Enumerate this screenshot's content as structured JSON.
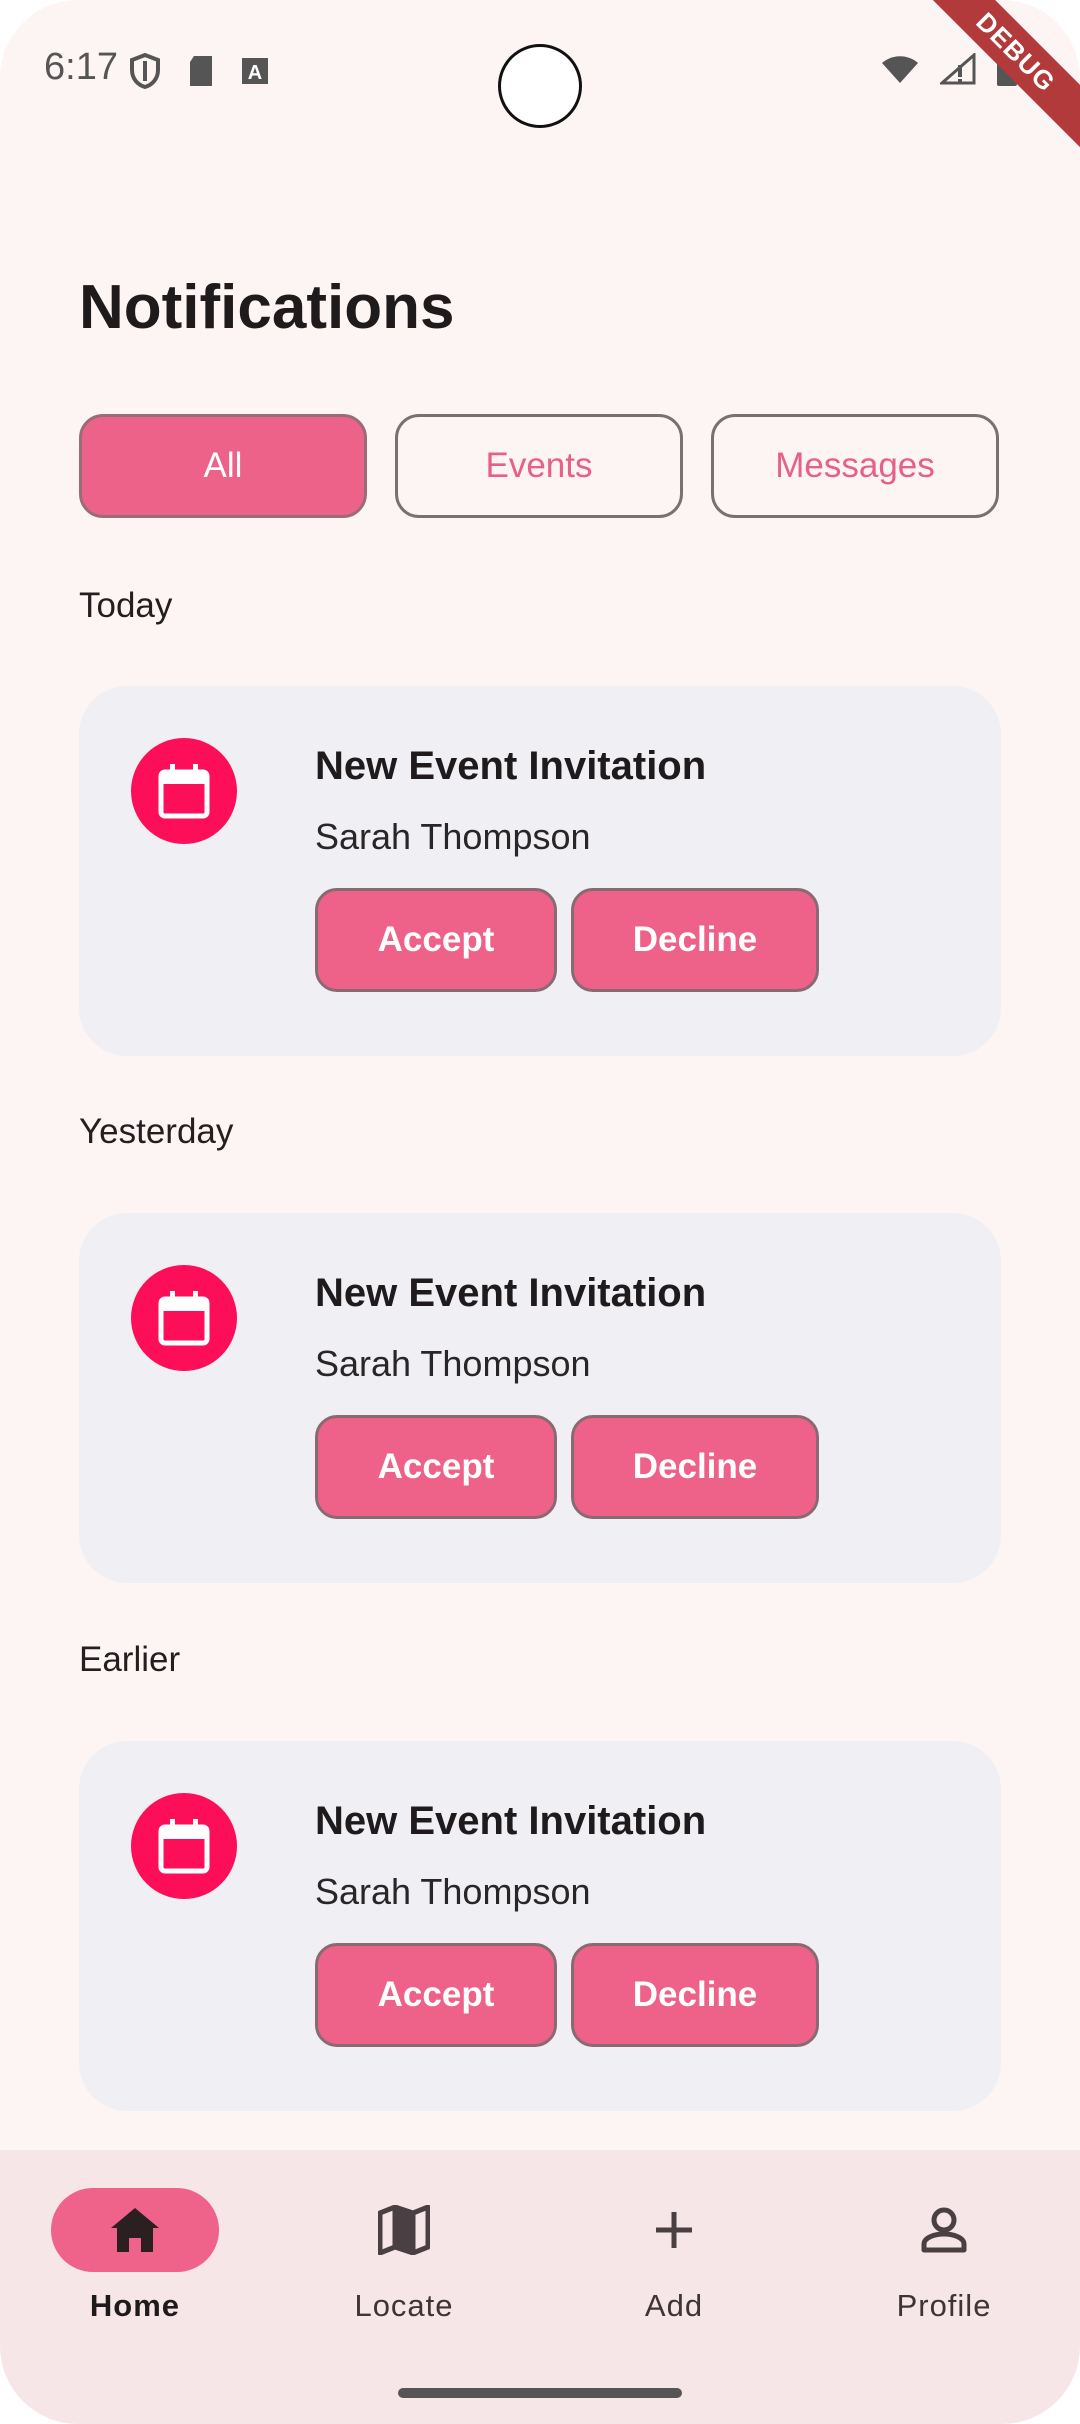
{
  "status_bar": {
    "time": "6:17",
    "debug_label": "DEBUG"
  },
  "title": "Notifications",
  "filters": [
    {
      "label": "All",
      "active": true
    },
    {
      "label": "Events",
      "active": false
    },
    {
      "label": "Messages",
      "active": false
    }
  ],
  "sections": [
    {
      "label": "Today",
      "card": {
        "title": "New Event Invitation",
        "sender": "Sarah Thompson",
        "accept_label": "Accept",
        "decline_label": "Decline",
        "icon": "calendar-icon"
      }
    },
    {
      "label": "Yesterday",
      "card": {
        "title": "New Event Invitation",
        "sender": "Sarah Thompson",
        "accept_label": "Accept",
        "decline_label": "Decline",
        "icon": "calendar-icon"
      }
    },
    {
      "label": "Earlier",
      "card": {
        "title": "New Event Invitation",
        "sender": "Sarah Thompson",
        "accept_label": "Accept",
        "decline_label": "Decline",
        "icon": "calendar-icon"
      }
    }
  ],
  "bottom_nav": [
    {
      "label": "Home",
      "icon": "home-icon",
      "active": true
    },
    {
      "label": "Locate",
      "icon": "map-icon",
      "active": false
    },
    {
      "label": "Add",
      "icon": "plus-icon",
      "active": false
    },
    {
      "label": "Profile",
      "icon": "person-icon",
      "active": false
    }
  ],
  "colors": {
    "accent": "#ED6289",
    "icon_bg": "#FC0F58",
    "background": "#FDF5F4",
    "card": "#F0EFF4"
  }
}
